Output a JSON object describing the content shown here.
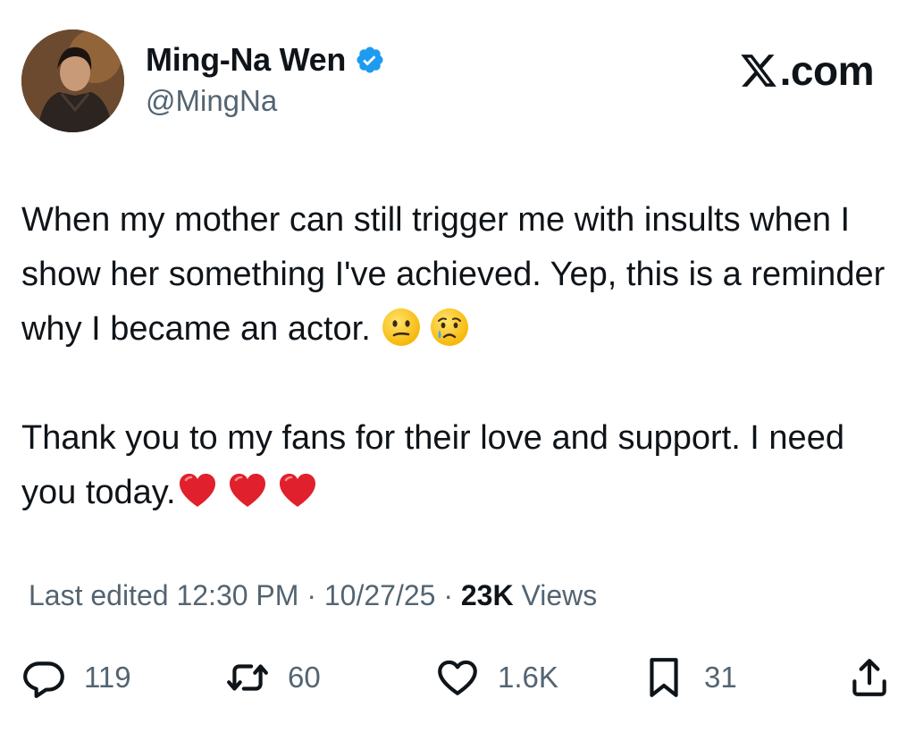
{
  "author": {
    "display_name": "Ming-Na Wen",
    "handle": "@MingNa",
    "verified": true
  },
  "brand": {
    "label": ".com"
  },
  "tweet": {
    "paragraph_1": "When my mother can still trigger me with insults when I show her something I've achieved. Yep, this is a reminder why I became an actor. ",
    "paragraph_2": "Thank you to my fans for their love and support. I need you today.",
    "emojis_1": [
      "confused-face",
      "crying-face"
    ],
    "emojis_2": [
      "red-heart",
      "red-heart",
      "red-heart"
    ]
  },
  "meta": {
    "edited_label": "Last edited 12:30 PM · 10/27/25 · ",
    "views_count": "23K",
    "views_label": " Views"
  },
  "actions": {
    "replies": "119",
    "reposts": "60",
    "likes": "1.6K",
    "bookmarks": "31"
  },
  "colors": {
    "text_primary": "#0f1419",
    "text_secondary": "#536471",
    "verified_blue": "#1d9bf0",
    "heart_red": "#e0202c"
  }
}
